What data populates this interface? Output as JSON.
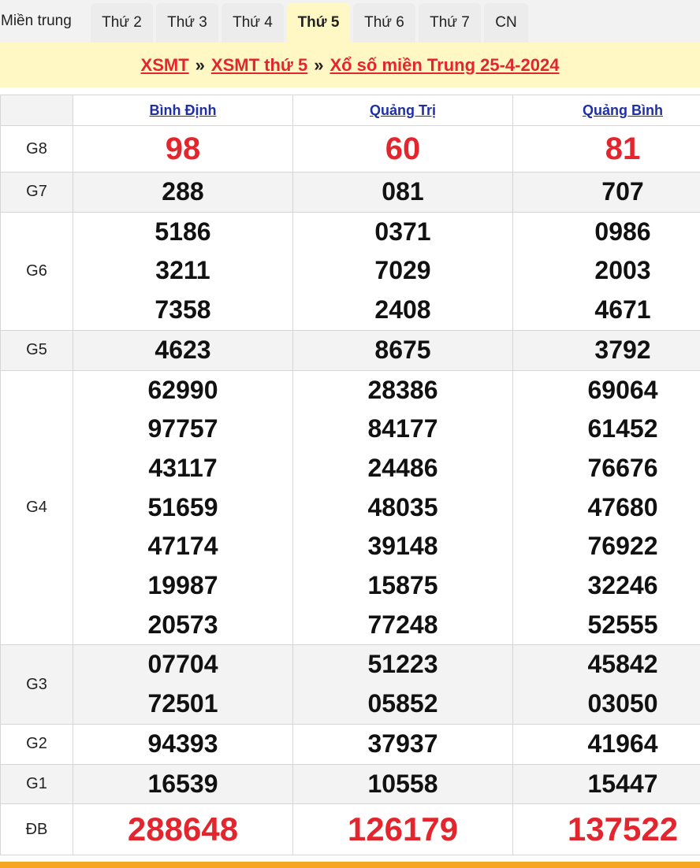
{
  "tabs": [
    {
      "label": "Miền trung",
      "active": false
    },
    {
      "label": "Thứ 2",
      "active": false
    },
    {
      "label": "Thứ 3",
      "active": false
    },
    {
      "label": "Thứ 4",
      "active": false
    },
    {
      "label": "Thứ 5",
      "active": true
    },
    {
      "label": "Thứ 6",
      "active": false
    },
    {
      "label": "Thứ 7",
      "active": false
    },
    {
      "label": "CN",
      "active": false
    }
  ],
  "breadcrumb": {
    "link1": "XSMT",
    "link2": "XSMT thứ 5",
    "link3": "Xổ số miền Trung 25-4-2024",
    "separator": "»"
  },
  "colors": {
    "accent_red": "#e3262d",
    "link_blue": "#1f2fa6",
    "banner_bg": "#fff7c4",
    "bottom_bar": "#f5a623"
  },
  "provinces": [
    "Bình Định",
    "Quảng Trị",
    "Quảng Bình"
  ],
  "prizes": [
    {
      "label": "G8",
      "style": "big-red",
      "values": [
        [
          "98"
        ],
        [
          "60"
        ],
        [
          "81"
        ]
      ]
    },
    {
      "label": "G7",
      "style": "normal",
      "values": [
        [
          "288"
        ],
        [
          "081"
        ],
        [
          "707"
        ]
      ]
    },
    {
      "label": "G6",
      "style": "normal",
      "values": [
        [
          "5186",
          "3211",
          "7358"
        ],
        [
          "0371",
          "7029",
          "2408"
        ],
        [
          "0986",
          "2003",
          "4671"
        ]
      ]
    },
    {
      "label": "G5",
      "style": "normal",
      "values": [
        [
          "4623"
        ],
        [
          "8675"
        ],
        [
          "3792"
        ]
      ]
    },
    {
      "label": "G4",
      "style": "normal",
      "values": [
        [
          "62990",
          "97757",
          "43117",
          "51659",
          "47174",
          "19987",
          "20573"
        ],
        [
          "28386",
          "84177",
          "24486",
          "48035",
          "39148",
          "15875",
          "77248"
        ],
        [
          "69064",
          "61452",
          "76676",
          "47680",
          "76922",
          "32246",
          "52555"
        ]
      ]
    },
    {
      "label": "G3",
      "style": "normal",
      "values": [
        [
          "07704",
          "72501"
        ],
        [
          "51223",
          "05852"
        ],
        [
          "45842",
          "03050"
        ]
      ]
    },
    {
      "label": "G2",
      "style": "normal",
      "values": [
        [
          "94393"
        ],
        [
          "37937"
        ],
        [
          "41964"
        ]
      ]
    },
    {
      "label": "G1",
      "style": "normal",
      "values": [
        [
          "16539"
        ],
        [
          "10558"
        ],
        [
          "15447"
        ]
      ]
    },
    {
      "label": "ĐB",
      "style": "special-red",
      "values": [
        [
          "288648"
        ],
        [
          "126179"
        ],
        [
          "137522"
        ]
      ]
    }
  ]
}
